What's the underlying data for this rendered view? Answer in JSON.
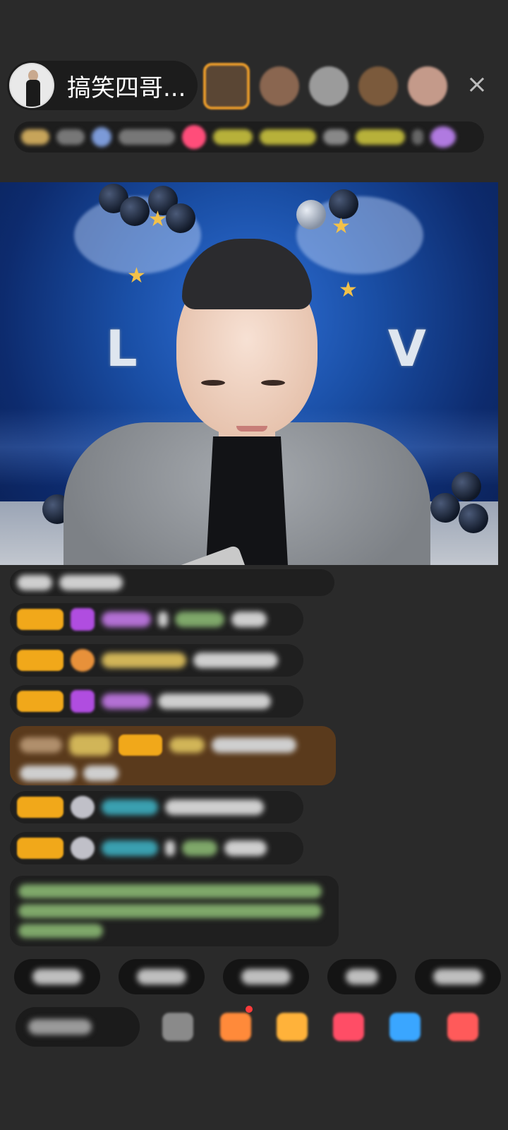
{
  "header": {
    "host_name": "搞笑四哥...",
    "viewer_avatars": [
      "viewer-1",
      "viewer-2",
      "viewer-3",
      "viewer-4",
      "viewer-5"
    ],
    "close_icon": "×"
  },
  "video": {
    "backdrop_text": "LOVE"
  },
  "chat": {
    "messages": [
      {
        "type": "system"
      },
      {
        "type": "user",
        "badge_color": "#f1a81a",
        "icon": "diamond-icon"
      },
      {
        "type": "user",
        "badge_color": "#f1a81a",
        "icon": "orange-icon"
      },
      {
        "type": "user",
        "badge_color": "#f1a81a",
        "icon": "diamond-icon"
      },
      {
        "type": "highlight"
      },
      {
        "type": "user",
        "badge_color": "#f1a81a",
        "icon": "grey-icon"
      },
      {
        "type": "user",
        "badge_color": "#f1a81a",
        "icon": "grey-icon"
      },
      {
        "type": "notice"
      }
    ]
  },
  "quick_chips": [
    "chip-1",
    "chip-2",
    "chip-3",
    "chip-4",
    "chip-5"
  ],
  "bottom_bar": {
    "icons": [
      "share-icon",
      "gift-box-icon",
      "shopping-bag-icon",
      "game-icon",
      "chat-icon",
      "gift-icon"
    ]
  },
  "colors": {
    "background": "#2a2a2a",
    "badge": "#f1a81a",
    "highlight_bg": "#5a3a1c",
    "accent_pink": "#ff4d7a"
  }
}
